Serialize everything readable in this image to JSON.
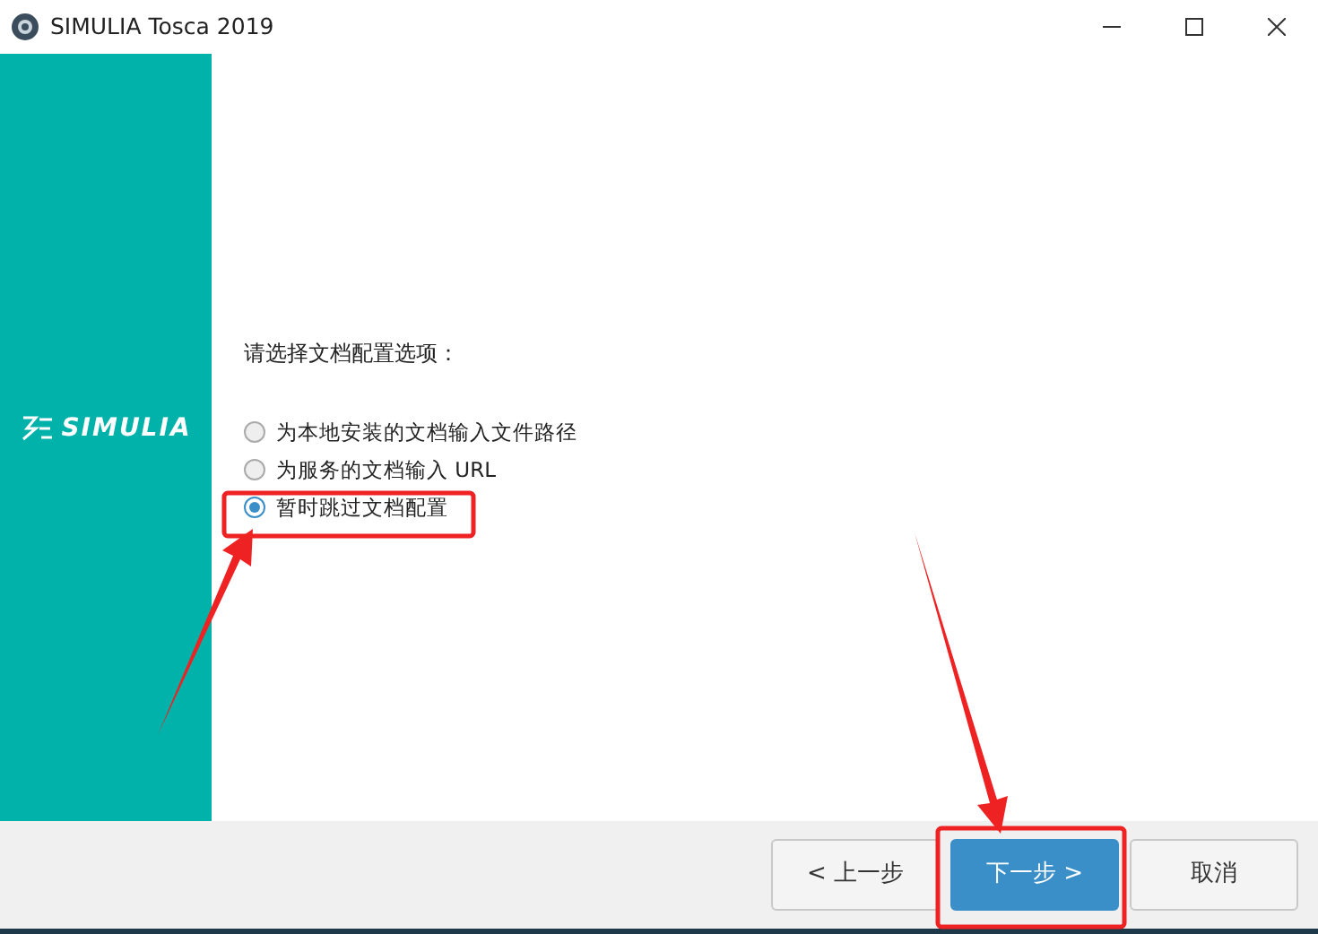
{
  "window": {
    "title": "SIMULIA Tosca 2019"
  },
  "sidebar": {
    "logo_text": "SIMULIA"
  },
  "prompt": "请选择文档配置选项：",
  "options": [
    {
      "label": "为本地安装的文档输入文件路径",
      "selected": false
    },
    {
      "label": "为服务的文档输入 URL",
      "selected": false
    },
    {
      "label": "暂时跳过文档配置",
      "selected": true
    }
  ],
  "buttons": [
    {
      "label": "< 上一步",
      "kind": "normal"
    },
    {
      "label": "下一步 >",
      "kind": "primary"
    },
    {
      "label": "取消",
      "kind": "normal"
    }
  ]
}
